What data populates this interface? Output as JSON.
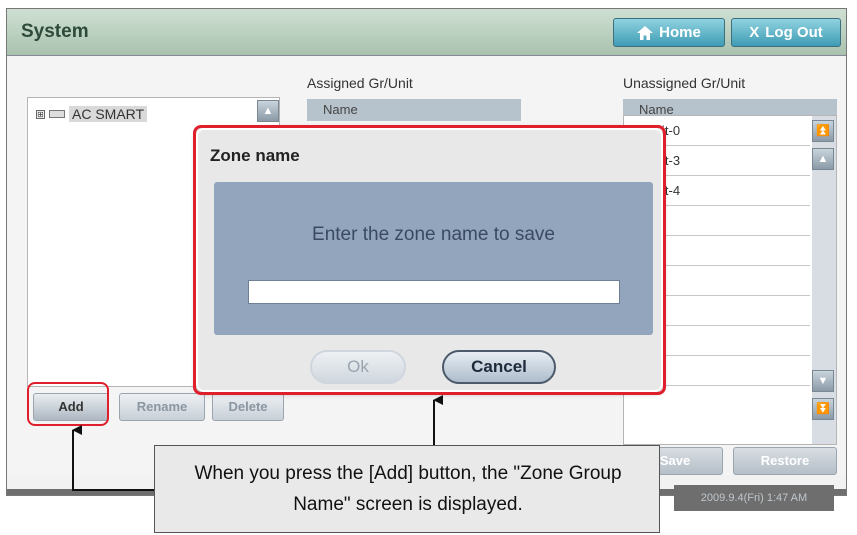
{
  "window": {
    "title": "System",
    "home_label": "Home",
    "logout_label": "Log Out",
    "logout_prefix": "X"
  },
  "tree": {
    "root_label": "AC SMART",
    "expander": "⊞"
  },
  "assigned": {
    "heading": "Assigned Gr/Unit",
    "column_name": "Name"
  },
  "unassigned": {
    "heading": "Unassigned Gr/Unit",
    "column_name": "Name",
    "rows": [
      "it-0",
      "it-3",
      "it-4",
      "",
      "",
      "",
      "",
      "",
      ""
    ]
  },
  "actions": {
    "add": "Add",
    "rename": "Rename",
    "delete": "Delete",
    "save": "Save",
    "restore": "Restore"
  },
  "status": {
    "datetime": "2009.9.4(Fri)  1:47 AM"
  },
  "dialog": {
    "title": "Zone name",
    "prompt": "Enter the zone name to save",
    "input_value": "",
    "ok": "Ok",
    "cancel": "Cancel"
  },
  "annotation": {
    "callout": "When you press the [Add] button, the \"Zone Group Name\" screen is displayed.",
    "highlight_color": "#e01f2c"
  }
}
